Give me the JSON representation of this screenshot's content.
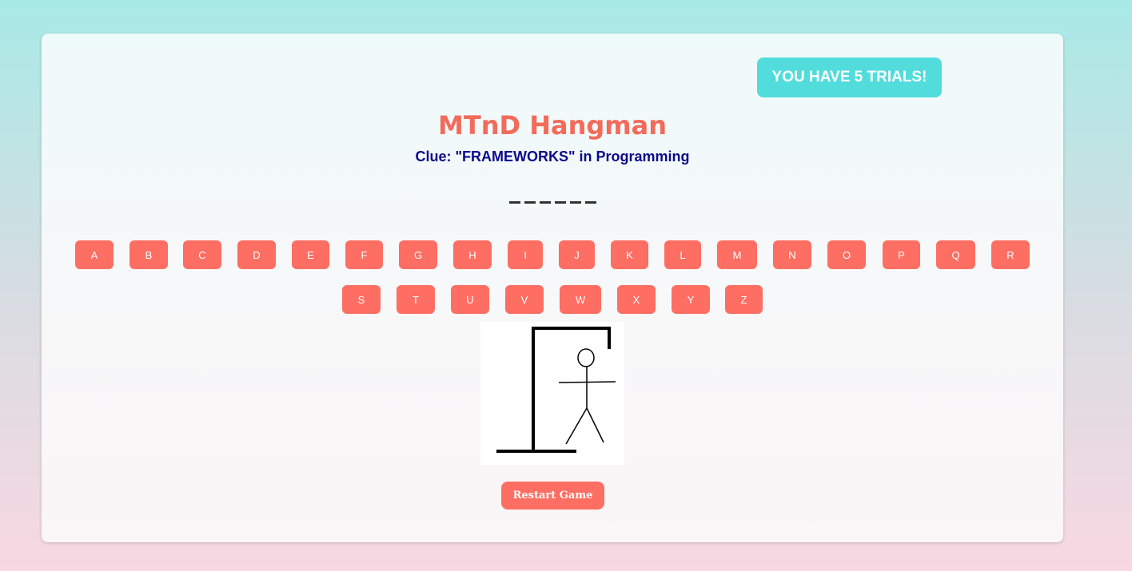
{
  "trials_label": "YOU HAVE 5 TRIALS!",
  "title": "MTnD Hangman",
  "clue": "Clue: \"FRAMEWORKS\" in Programming",
  "word_blank_count": 6,
  "letters_row1": [
    "A",
    "B",
    "C",
    "D",
    "E",
    "F",
    "G",
    "H",
    "I",
    "J",
    "K",
    "L",
    "M",
    "N",
    "O",
    "P",
    "Q",
    "R"
  ],
  "letters_row2": [
    "S",
    "T",
    "U",
    "V",
    "W",
    "X",
    "Y",
    "Z"
  ],
  "restart_label": "Restart Game",
  "colors": {
    "accent": "#fe6e62",
    "title": "#f26b5b",
    "clue": "#0a0a8a",
    "trials_bg": "#52dcdc"
  },
  "icons": {
    "gallows": "hangman-figure-icon"
  }
}
